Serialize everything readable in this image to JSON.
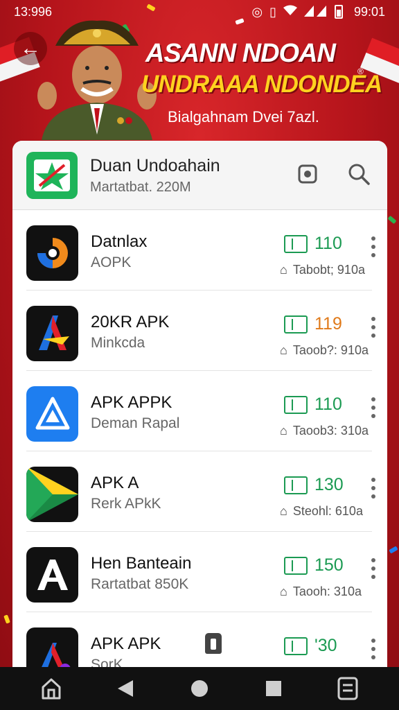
{
  "status_bar": {
    "time": "13:996",
    "right_time": "99:01"
  },
  "header": {
    "title_line1": "ASANN NDOAN",
    "title_line2": "UNDRAAA NDONDEA",
    "registered": "®",
    "subtitle": "Bialgahnam Dvei 7azl."
  },
  "card_header": {
    "title": "Duan Undoahain",
    "subtitle": "Martatbat. 220M",
    "logo_icon": "star-map-icon",
    "badge_icon": "record-icon",
    "search_icon": "search-icon"
  },
  "apps": [
    {
      "title": "Datnlax",
      "subtitle": "AOPK",
      "count": "110",
      "meta": "Tabobt; 910a",
      "icon": "swirl-app-icon",
      "icon_bg": "#111111",
      "count_color": "green"
    },
    {
      "title": "20KR APK",
      "subtitle": "Minkcda",
      "count": "119",
      "meta": "Taoob?: 910a",
      "icon": "a-letter-app-icon",
      "icon_bg": "#111111",
      "count_color": "orange"
    },
    {
      "title": "APK APPK",
      "subtitle": "Deman Rapal",
      "count": "110",
      "meta": "Taoob3: 310a",
      "icon": "triangle-app-icon",
      "icon_bg": "#1e7ef0",
      "count_color": "green"
    },
    {
      "title": "APK A",
      "subtitle": "Rerk APkK",
      "count": "130",
      "meta": "Steohl: 610a",
      "icon": "play-app-icon",
      "icon_bg": "#111111",
      "count_color": "green"
    },
    {
      "title": "Hen Banteain",
      "subtitle": "Rartatbat 850K",
      "count": "150",
      "meta": "Taooh: 310a",
      "icon": "a-white-app-icon",
      "icon_bg": "#111111",
      "count_color": "green"
    },
    {
      "title": "APK APK",
      "subtitle": "SorK",
      "count": "'30",
      "meta": "",
      "icon": "a-color-app-icon",
      "icon_bg": "#111111",
      "count_color": "green"
    }
  ],
  "nav": {
    "home_icon": "home-icon",
    "back_icon": "back-triangle-icon",
    "circle_icon": "home-circle-icon",
    "recents_icon": "recents-square-icon",
    "menu_icon": "menu-box-icon"
  },
  "colors": {
    "brand_red": "#b3141c",
    "accent_green": "#1b9a52",
    "accent_orange": "#e07a1a",
    "title_yellow": "#ffd21f"
  }
}
